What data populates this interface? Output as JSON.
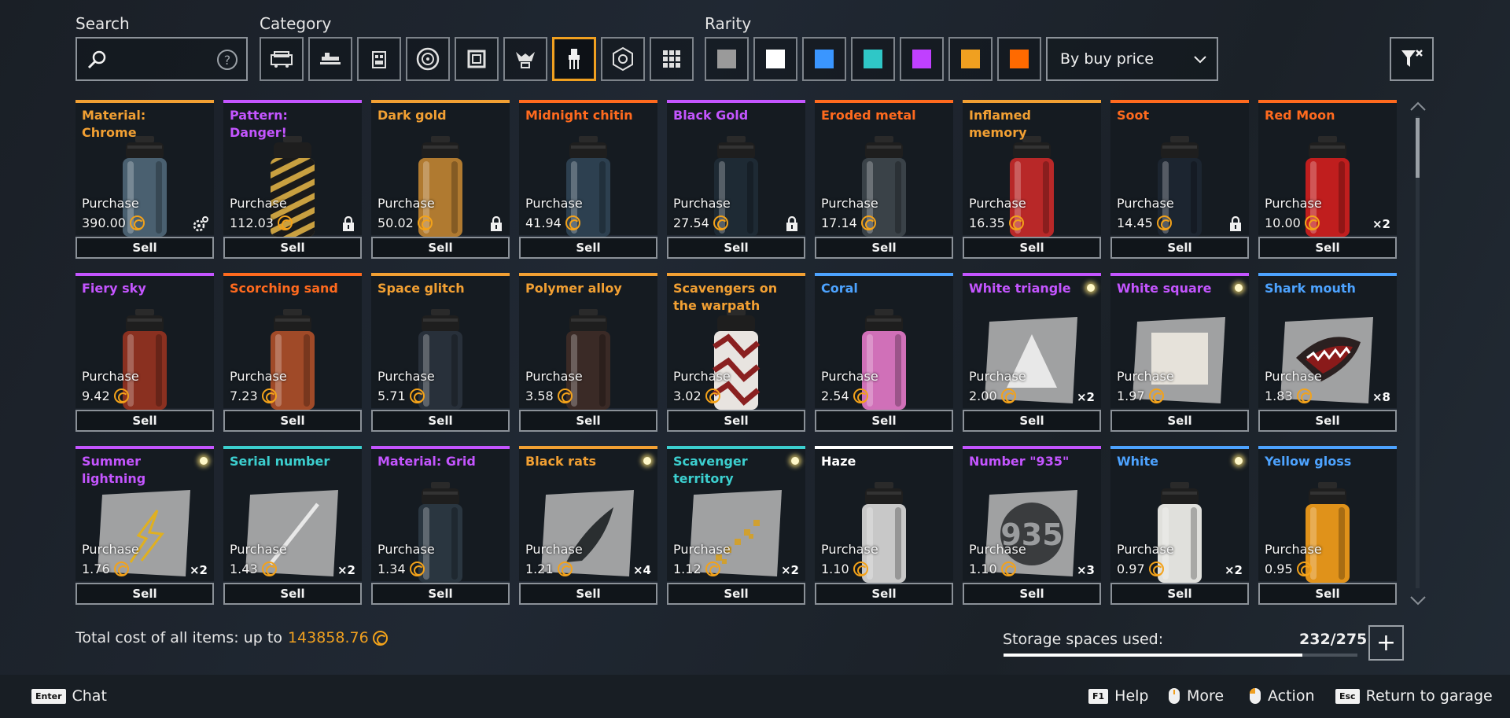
{
  "filters": {
    "search_label": "Search",
    "search_value": "",
    "category_label": "Category",
    "categories": [
      "cabin-icon",
      "weapon-icon",
      "module-icon",
      "wheel-icon",
      "frame-icon",
      "decor-icon",
      "paint-icon",
      "structure-icon",
      "all-icon"
    ],
    "active_category": "paint-icon",
    "rarity_label": "Rarity",
    "rarity_colors": [
      "#9a9a9a",
      "#ffffff",
      "#3a96ff",
      "#2fc7c7",
      "#c040ff",
      "#f0a020",
      "#ff6a00"
    ],
    "sort_value": "By buy price"
  },
  "colors": {
    "common": "#bdbdbd",
    "white": "#ffffff",
    "rare": "#4da3ff",
    "special": "#3ccfcf",
    "epic": "#c455ff",
    "legendary": "#f2a033",
    "relic": "#ff6a1e",
    "coin": "#f3a21a"
  },
  "items": [
    {
      "name": "Material: Chrome",
      "rarity": "legendary",
      "purchase_label": "Purchase",
      "price": "390.00",
      "badge": "gear",
      "qty": "",
      "sell": "Sell",
      "art": "can",
      "can_color": "#4a6070"
    },
    {
      "name": "Pattern: Danger!",
      "rarity": "epic",
      "purchase_label": "Purchase",
      "price": "112.03",
      "badge": "lock",
      "qty": "",
      "sell": "Sell",
      "art": "hazard",
      "can_color": "#c9a040"
    },
    {
      "name": "Dark gold",
      "rarity": "legendary",
      "purchase_label": "Purchase",
      "price": "50.02",
      "badge": "lock",
      "qty": "",
      "sell": "Sell",
      "art": "can",
      "can_color": "#b07a30"
    },
    {
      "name": "Midnight chitin",
      "rarity": "relic",
      "purchase_label": "Purchase",
      "price": "41.94",
      "badge": "",
      "qty": "",
      "sell": "Sell",
      "art": "can",
      "can_color": "#2d4050"
    },
    {
      "name": "Black Gold",
      "rarity": "epic",
      "purchase_label": "Purchase",
      "price": "27.54",
      "badge": "lock",
      "qty": "",
      "sell": "Sell",
      "art": "can",
      "can_color": "#1e2a34"
    },
    {
      "name": "Eroded metal",
      "rarity": "relic",
      "purchase_label": "Purchase",
      "price": "17.14",
      "badge": "",
      "qty": "",
      "sell": "Sell",
      "art": "can",
      "can_color": "#3a4248"
    },
    {
      "name": "Inflamed memory",
      "rarity": "legendary",
      "purchase_label": "Purchase",
      "price": "16.35",
      "badge": "",
      "qty": "",
      "sell": "Sell",
      "art": "can",
      "can_color": "#b82828"
    },
    {
      "name": "Soot",
      "rarity": "relic",
      "purchase_label": "Purchase",
      "price": "14.45",
      "badge": "lock",
      "qty": "",
      "sell": "Sell",
      "art": "can",
      "can_color": "#1c2530"
    },
    {
      "name": "Red Moon",
      "rarity": "relic",
      "purchase_label": "Purchase",
      "price": "10.00",
      "badge": "",
      "qty": "×2",
      "sell": "Sell",
      "art": "can",
      "can_color": "#c01e1e"
    },
    {
      "name": "Fiery sky",
      "rarity": "epic",
      "purchase_label": "Purchase",
      "price": "9.42",
      "badge": "",
      "qty": "",
      "sell": "Sell",
      "art": "can",
      "can_color": "#8a3020"
    },
    {
      "name": "Scorching sand",
      "rarity": "relic",
      "purchase_label": "Purchase",
      "price": "7.23",
      "badge": "",
      "qty": "",
      "sell": "Sell",
      "art": "can",
      "can_color": "#a04a28"
    },
    {
      "name": "Space glitch",
      "rarity": "legendary",
      "purchase_label": "Purchase",
      "price": "5.71",
      "badge": "",
      "qty": "",
      "sell": "Sell",
      "art": "can",
      "can_color": "#28303a"
    },
    {
      "name": "Polymer alloy",
      "rarity": "legendary",
      "purchase_label": "Purchase",
      "price": "3.58",
      "badge": "",
      "qty": "",
      "sell": "Sell",
      "art": "can",
      "can_color": "#3a2a26"
    },
    {
      "name": "Scavengers on the warpath",
      "rarity": "legendary",
      "purchase_label": "Purchase",
      "price": "3.02",
      "badge": "",
      "qty": "",
      "sell": "Sell",
      "art": "zigzag",
      "can_color": "#e8e4e0"
    },
    {
      "name": "Coral",
      "rarity": "rare",
      "purchase_label": "Purchase",
      "price": "2.54",
      "badge": "",
      "qty": "",
      "sell": "Sell",
      "art": "can",
      "can_color": "#d070b8"
    },
    {
      "name": "White triangle",
      "rarity": "epic",
      "purchase_label": "Purchase",
      "price": "2.00",
      "badge": "",
      "qty": "×2",
      "sell": "Sell",
      "art": "decal-triangle",
      "dot": true
    },
    {
      "name": "White square",
      "rarity": "epic",
      "purchase_label": "Purchase",
      "price": "1.97",
      "badge": "",
      "qty": "",
      "sell": "Sell",
      "art": "decal-square",
      "dot": true
    },
    {
      "name": "Shark mouth",
      "rarity": "rare",
      "purchase_label": "Purchase",
      "price": "1.83",
      "badge": "",
      "qty": "×8",
      "sell": "Sell",
      "art": "decal-shark"
    },
    {
      "name": "Summer lightning",
      "rarity": "epic",
      "purchase_label": "Purchase",
      "price": "1.76",
      "badge": "",
      "qty": "×2",
      "sell": "Sell",
      "art": "decal-lightning",
      "dot": true
    },
    {
      "name": "Serial number",
      "rarity": "special",
      "purchase_label": "Purchase",
      "price": "1.43",
      "badge": "",
      "qty": "×2",
      "sell": "Sell",
      "art": "decal-stroke"
    },
    {
      "name": "Material: Grid",
      "rarity": "epic",
      "purchase_label": "Purchase",
      "price": "1.34",
      "badge": "",
      "qty": "",
      "sell": "Sell",
      "art": "can",
      "can_color": "#2a3640"
    },
    {
      "name": "Black rats",
      "rarity": "legendary",
      "purchase_label": "Purchase",
      "price": "1.21",
      "badge": "",
      "qty": "×4",
      "sell": "Sell",
      "art": "decal-rats",
      "dot": true
    },
    {
      "name": "Scavenger territory",
      "rarity": "special",
      "purchase_label": "Purchase",
      "price": "1.12",
      "badge": "",
      "qty": "×2",
      "sell": "Sell",
      "art": "decal-checker",
      "dot": true
    },
    {
      "name": "Haze",
      "rarity": "white",
      "purchase_label": "Purchase",
      "price": "1.10",
      "badge": "",
      "qty": "",
      "sell": "Sell",
      "art": "can",
      "can_color": "#c8c8c8"
    },
    {
      "name": "Number \"935\"",
      "rarity": "epic",
      "purchase_label": "Purchase",
      "price": "1.10",
      "badge": "",
      "qty": "×3",
      "sell": "Sell",
      "art": "decal-935",
      "decal_text": "935"
    },
    {
      "name": "White",
      "rarity": "rare",
      "purchase_label": "Purchase",
      "price": "0.97",
      "badge": "",
      "qty": "×2",
      "sell": "Sell",
      "art": "can",
      "can_color": "#e0e0dc",
      "dot": true
    },
    {
      "name": "Yellow gloss",
      "rarity": "rare",
      "purchase_label": "Purchase",
      "price": "0.95",
      "badge": "",
      "qty": "",
      "sell": "Sell",
      "art": "can",
      "can_color": "#e0921a"
    }
  ],
  "footer": {
    "total_label": "Total cost of all items: up to",
    "total_value": "143858.76",
    "storage_label": "Storage spaces used:",
    "storage_value": "232/275",
    "storage_fraction": 0.8436,
    "storage_add": "+"
  },
  "hints": {
    "chat_key": "Enter",
    "chat_label": "Chat",
    "help_key": "F1",
    "help_label": "Help",
    "more_label": "More",
    "action_label": "Action",
    "return_key": "Esc",
    "return_label": "Return to garage"
  }
}
